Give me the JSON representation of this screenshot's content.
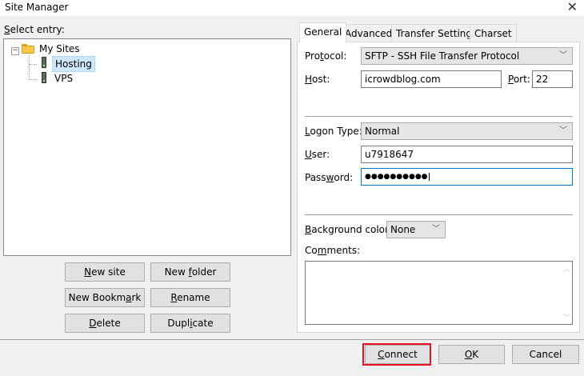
{
  "window": {
    "title": "Site Manager"
  },
  "tree": {
    "label_pre": "",
    "label_u": "S",
    "label_post": "elect entry:",
    "root": "My Sites",
    "children": [
      "Hosting",
      "VPS"
    ]
  },
  "buttons": {
    "new_site": {
      "pre": "",
      "u": "N",
      "post": "ew site"
    },
    "new_folder": {
      "pre": "New ",
      "u": "f",
      "post": "older"
    },
    "new_bookmark": {
      "pre": "New Bookm",
      "u": "a",
      "post": "rk"
    },
    "rename": {
      "pre": "",
      "u": "R",
      "post": "ename"
    },
    "delete": {
      "pre": "",
      "u": "D",
      "post": "elete"
    },
    "duplicate": {
      "pre": "Dupl",
      "u": "i",
      "post": "cate"
    }
  },
  "tabs": [
    "General",
    "Advanced",
    "Transfer Settings",
    "Charset"
  ],
  "general": {
    "protocol": {
      "pre": "Pro",
      "u": "t",
      "post": "ocol:",
      "value": "SFTP - SSH File Transfer Protocol"
    },
    "host": {
      "pre": "",
      "u": "H",
      "post": "ost:",
      "value": "icrowdblog.com"
    },
    "port": {
      "pre": "",
      "u": "P",
      "post": "ort:",
      "value": "22"
    },
    "logon_type": {
      "pre": "",
      "u": "L",
      "post": "ogon Type:",
      "value": "Normal"
    },
    "user": {
      "pre": "",
      "u": "U",
      "post": "ser:",
      "value": "u7918647"
    },
    "password": {
      "pre": "Pass",
      "u": "w",
      "post": "ord:",
      "value": "●●●●●●●●●●"
    },
    "background_color": {
      "pre": "",
      "u": "B",
      "post": "ackground color:",
      "value": "None"
    },
    "comments": {
      "pre": "Co",
      "u": "m",
      "post": "ments:"
    }
  },
  "footer": {
    "connect": {
      "pre": "",
      "u": "C",
      "post": "onnect"
    },
    "ok": {
      "pre": "",
      "u": "O",
      "post": "K"
    },
    "cancel": "Cancel"
  },
  "colors": {
    "highlight": "#e81123",
    "focus_border": "#0078d7"
  }
}
